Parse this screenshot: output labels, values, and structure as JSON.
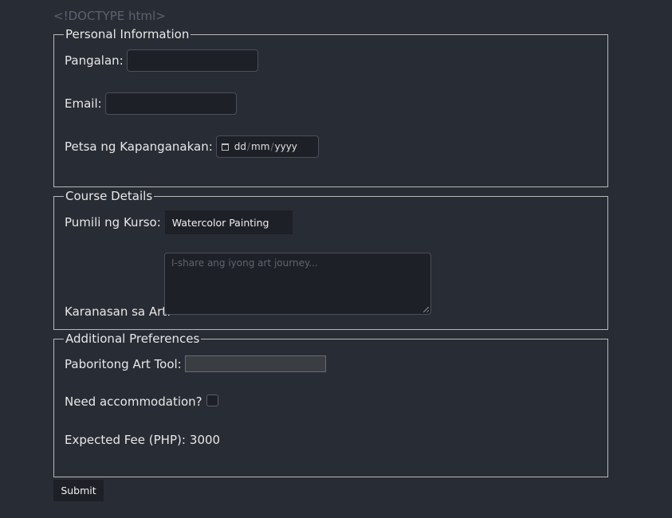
{
  "doctype_text": "<!DOCTYPE html>",
  "personal": {
    "legend": "Personal Information",
    "name_label": "Pangalan:",
    "name_value": "",
    "email_label": "Email:",
    "email_value": "",
    "birthdate_label": "Petsa ng Kapanganakan:",
    "date_day": "dd",
    "date_month": "mm",
    "date_year": "yyyy",
    "date_separator": "/"
  },
  "course": {
    "legend": "Course Details",
    "course_label": "Pumili ng Kurso:",
    "course_selected": "Watercolor Painting",
    "experience_label": "Karanasan sa Art:",
    "experience_placeholder": "I-share ang iyong art journey..."
  },
  "preferences": {
    "legend": "Additional Preferences",
    "art_tool_label": "Paboritong Art Tool:",
    "art_tool_value": "",
    "accommodation_label": "Need accommodation?",
    "accommodation_checked": false,
    "fee_label": "Expected Fee (PHP):",
    "fee_value": "3000"
  },
  "submit_label": "Submit",
  "colors": {
    "background": "#282c34",
    "input_bg": "#1e2027",
    "border": "#b8b8b8"
  },
  "icons": {
    "date_picker": "calendar-icon"
  }
}
